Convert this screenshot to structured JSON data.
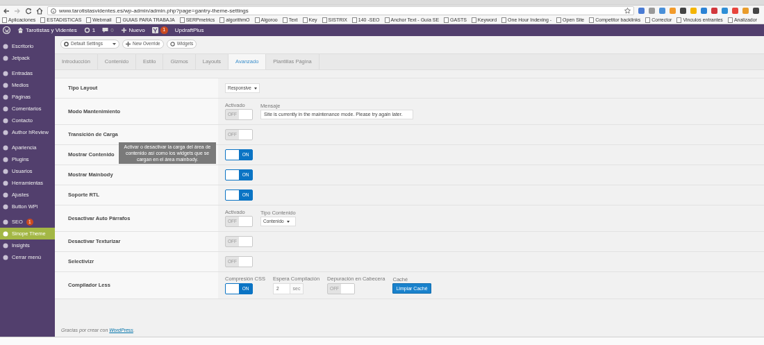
{
  "browser": {
    "url": "www.tarotistasvidentes.es/wp-admin/admin.php?page=gantry-theme-settings",
    "bookmarks": [
      "Aplicaciones",
      "ESTADISTICAS",
      "Webmail",
      "GUIAS PARA TRABAJA",
      "SERPmetrics",
      "algorithmO",
      "Algoroo",
      "Text",
      "Key",
      "SISTRIX",
      "140 -SEO",
      "Anchor Text - Guía SE",
      "GASTS",
      "Keyword",
      "One Hour Indexing -",
      "Open Site",
      "Competitor backlinks",
      "Corrector",
      "Vinculos entrantes",
      "Analizador"
    ]
  },
  "admin_bar": {
    "site": "Tarotistas y Videntes",
    "updates": "1",
    "comments": "0",
    "new": "Nuevo",
    "seo_badge": "1",
    "plugin": "UpdraftPlus"
  },
  "sidebar": {
    "groups": [
      {
        "items": [
          {
            "label": "Escritorio",
            "selected": false
          },
          {
            "label": "Jetpack",
            "selected": false
          }
        ]
      },
      {
        "items": [
          {
            "label": "Entradas",
            "selected": false
          },
          {
            "label": "Medios",
            "selected": false
          },
          {
            "label": "Páginas",
            "selected": false
          },
          {
            "label": "Comentarios",
            "selected": false
          },
          {
            "label": "Contacto",
            "selected": false
          },
          {
            "label": "Author hReview",
            "selected": false
          }
        ]
      },
      {
        "items": [
          {
            "label": "Apariencia",
            "selected": false
          },
          {
            "label": "Plugins",
            "selected": false
          },
          {
            "label": "Usuarios",
            "selected": false
          },
          {
            "label": "Herramientas",
            "selected": false
          },
          {
            "label": "Ajustes",
            "selected": false
          },
          {
            "label": "Button WPi",
            "selected": false
          }
        ]
      },
      {
        "items": [
          {
            "label": "SEO",
            "selected": false,
            "badge": "1"
          },
          {
            "label": "Sinope Theme",
            "selected": true
          },
          {
            "label": "Insights",
            "selected": false
          },
          {
            "label": "Cerrar menú",
            "selected": false
          }
        ]
      }
    ]
  },
  "toolbar": {
    "override_select": "Default Settings",
    "new_override": "New Override",
    "widgets": "Widgets"
  },
  "tabs": [
    {
      "label": "Introducción",
      "selected": false
    },
    {
      "label": "Contenido",
      "selected": false
    },
    {
      "label": "Estilo",
      "selected": false
    },
    {
      "label": "Gizmos",
      "selected": false
    },
    {
      "label": "Layouts",
      "selected": false
    },
    {
      "label": "Avanzado",
      "selected": true
    },
    {
      "label": "Plantillas Página",
      "selected": false
    }
  ],
  "settings": [
    {
      "label": "Tipo Layout",
      "controls": [
        {
          "kind": "select",
          "value": "Responsive"
        }
      ]
    },
    {
      "label": "Modo Mantenimiento",
      "controls": [
        {
          "kind": "toggle",
          "caption": "Activado",
          "on": false,
          "text": "OFF"
        },
        {
          "kind": "text",
          "caption": "Mensaje",
          "value": "Site is currently in the maintenance mode. Please try again later."
        }
      ]
    },
    {
      "label": "Transición de Carga",
      "controls": [
        {
          "kind": "toggle",
          "on": false,
          "text": "OFF"
        }
      ]
    },
    {
      "label": "Mostrar Contenido",
      "tooltip": "Activar o desactivar la carga del área de contenido así como los widgets que se cargan en el área mainbody.",
      "controls": [
        {
          "kind": "toggle",
          "on": true,
          "text": "ON"
        }
      ]
    },
    {
      "label": "Mostrar Mainbody",
      "controls": [
        {
          "kind": "toggle",
          "on": true,
          "text": "ON"
        }
      ]
    },
    {
      "label": "Soporte RTL",
      "controls": [
        {
          "kind": "toggle",
          "on": true,
          "text": "ON"
        }
      ]
    },
    {
      "label": "Desactivar Auto Párrafos",
      "controls": [
        {
          "kind": "toggle",
          "caption": "Activado",
          "on": false,
          "text": "OFF"
        },
        {
          "kind": "select",
          "caption": "Tipo Contenido",
          "value": "Contenido"
        }
      ]
    },
    {
      "label": "Desactivar Texturizar",
      "controls": [
        {
          "kind": "toggle",
          "on": false,
          "text": "OFF"
        }
      ]
    },
    {
      "label": "Selectivizr",
      "controls": [
        {
          "kind": "toggle",
          "on": false,
          "text": "OFF"
        }
      ]
    },
    {
      "label": "Compilador Less",
      "controls": [
        {
          "kind": "toggle",
          "caption": "Compresión CSS",
          "on": true,
          "text": "ON"
        },
        {
          "kind": "number",
          "caption": "Espera Compilación",
          "value": "2",
          "unit": "sec"
        },
        {
          "kind": "toggle",
          "caption": "Depuración en Cabecera",
          "on": false,
          "text": "OFF"
        },
        {
          "kind": "button",
          "caption": "Caché",
          "text": "Limpiar Caché"
        }
      ]
    }
  ],
  "footer": {
    "before": "Gracias por crear con ",
    "link": "WordPress",
    "after": "."
  }
}
